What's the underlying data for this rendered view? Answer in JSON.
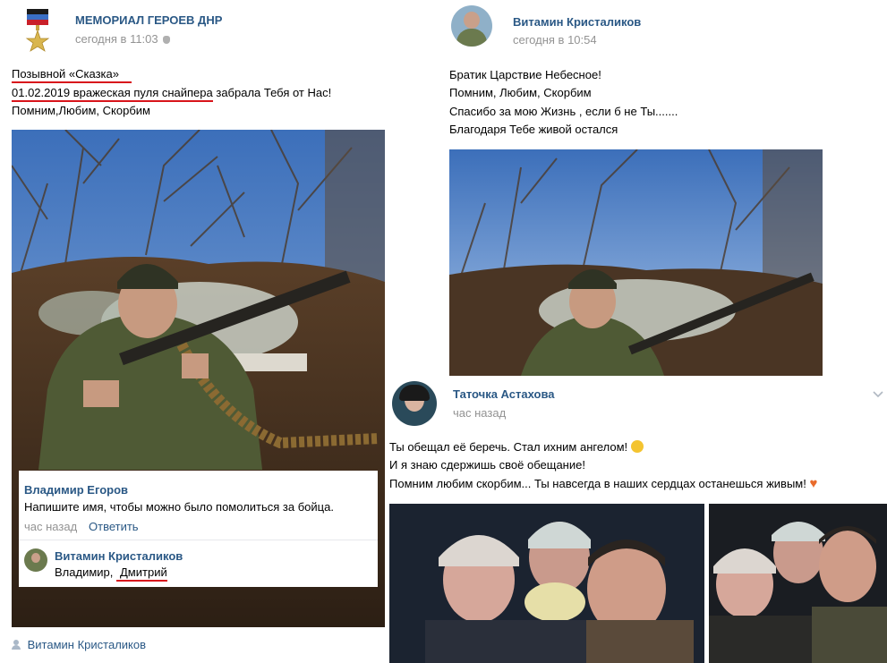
{
  "post1": {
    "author": "МЕМОРИАЛ ГЕРОЕВ ДНР",
    "time": "сегодня в 11:03",
    "time_icon": "apple-icon",
    "line1_underlined": "Позывной «Сказка»",
    "line2_date": "01.02.2019",
    "line2_underlined": "вражеская пуля снайпера",
    "line2_rest": " забрала Тебя от Нас!",
    "line3": "Помним,Любим, Скорбим",
    "signer": "Витамин Кристаликов",
    "signer_icon": "person-icon"
  },
  "comment_card": {
    "c1_author": "Владимир Егоров",
    "c1_text": "Напишите имя, чтобы можно было помолиться за бойца.",
    "c1_time": "час назад",
    "c1_reply": "Ответить",
    "c2_author": "Витамин Кристаликов",
    "c2_text_prefix": "Владимир, ",
    "c2_text_underlined": "Дмитрий"
  },
  "post2": {
    "author": "Витамин Кристаликов",
    "time": "сегодня в 10:54",
    "lines": [
      "Братик Царствие Небесное!",
      "Помним, Любим, Скорбим",
      "Спасибо за мою Жизнь , если б не Ты.......",
      "Благодаря Тебе живой остался"
    ]
  },
  "post3": {
    "author": "Таточка Астахова",
    "time": "час назад",
    "line1": "Ты обещал её беречь. Стал ихним ангелом!",
    "line2": "И я знаю сдержишь своё обещание!",
    "line3": "Помним любим скорбим... Ты навсегда в наших сердцах останешься живым!",
    "emoji1": "face-emoji",
    "emoji2": "heart-emoji",
    "menu_icon": "chevron-down-icon"
  },
  "colors": {
    "link": "#2a5885",
    "muted": "#939393",
    "underline": "#d8141b",
    "sky": "#4d7fc4"
  }
}
